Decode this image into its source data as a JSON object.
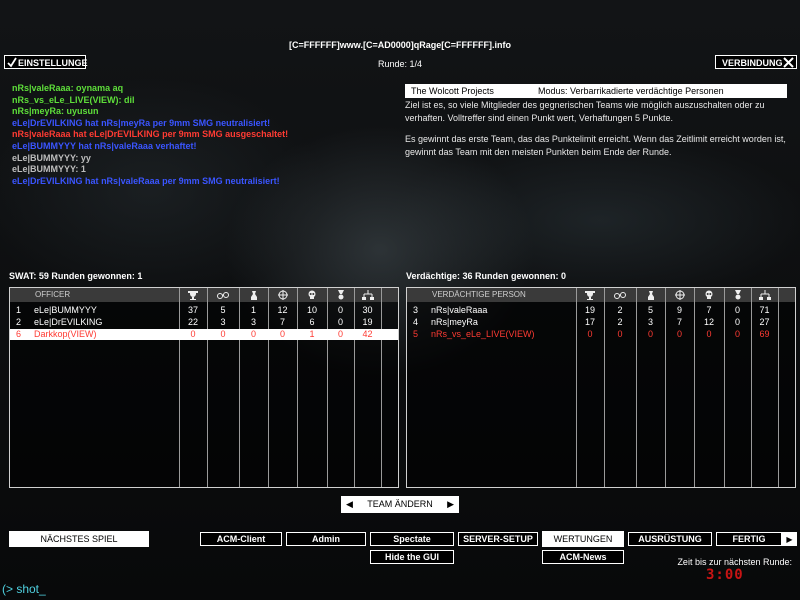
{
  "header": {
    "server_title": "[C=FFFFFF]www.[C=AD0000]qRage[C=FFFFFF].info",
    "round": "Runde: 1/4",
    "settings_button": "EINSTELLUNGE",
    "connection_button": "VERBINDUNG"
  },
  "chat": [
    {
      "parts": [
        {
          "text": "nRs|valeRaaa",
          "color": "green"
        },
        {
          "text": ": oynama aq",
          "color": "green"
        }
      ]
    },
    {
      "parts": [
        {
          "text": "nRs_vs_eLe_LIVE(VIEW)",
          "color": "green"
        },
        {
          "text": ": dil",
          "color": "green"
        }
      ]
    },
    {
      "parts": [
        {
          "text": "nRs|meyRa",
          "color": "green"
        },
        {
          "text": ": uyusun",
          "color": "green"
        }
      ]
    },
    {
      "parts": [
        {
          "text": "eLe|DrEVILKING",
          "color": "blue"
        },
        {
          "text": " hat ",
          "color": "blue"
        },
        {
          "text": "nRs|meyRa",
          "color": "blue"
        },
        {
          "text": " per 9mm SMG neutralisiert!",
          "color": "blue"
        }
      ]
    },
    {
      "parts": [
        {
          "text": "nRs|valeRaaa",
          "color": "red"
        },
        {
          "text": " hat ",
          "color": "red"
        },
        {
          "text": "eLe|DrEVILKING",
          "color": "red"
        },
        {
          "text": " per 9mm SMG ausgeschaltet!",
          "color": "red"
        }
      ]
    },
    {
      "parts": [
        {
          "text": "eLe|BUMMYYY",
          "color": "blue"
        },
        {
          "text": " hat ",
          "color": "blue"
        },
        {
          "text": "nRs|valeRaaa",
          "color": "blue"
        },
        {
          "text": " verhaftet!",
          "color": "blue"
        }
      ]
    },
    {
      "parts": [
        {
          "text": "eLe|BUMMYYY",
          "color": "gray"
        },
        {
          "text": ": yy",
          "color": "gray"
        }
      ]
    },
    {
      "parts": [
        {
          "text": "eLe|BUMMYYY",
          "color": "gray"
        },
        {
          "text": ": 1",
          "color": "gray"
        }
      ]
    },
    {
      "parts": [
        {
          "text": "eLe|DrEVILKING",
          "color": "blue"
        },
        {
          "text": " hat ",
          "color": "blue"
        },
        {
          "text": "nRs|valeRaaa",
          "color": "blue"
        },
        {
          "text": " per 9mm SMG neutralisiert!",
          "color": "blue"
        }
      ]
    }
  ],
  "info": {
    "map_name": "The Wolcott Projects",
    "mode": "Modus: Verbarrikadierte verdächtige Personen",
    "paragraph1": "Ziel ist es, so viele Mitglieder des gegnerischen Teams wie möglich auszuschalten oder zu verhaften. Volltreffer sind einen Punkt wert, Verhaftungen 5 Punkte.",
    "paragraph2": "Es gewinnt das erste Team, das das Punktelimit erreicht. Wenn das Zeitlimit erreicht worden ist, gewinnt das Team mit den meisten Punkten beim Ende der Runde."
  },
  "swat": {
    "label": "SWAT: 59   Runden gewonnen: 1",
    "header": "OFFICER",
    "rows": [
      {
        "num": "1",
        "name": "eLe|BUMMYYY",
        "stats": [
          "37",
          "5",
          "1",
          "12",
          "10",
          "0",
          "30"
        ],
        "style": "normal"
      },
      {
        "num": "2",
        "name": "eLe|DrEVILKING",
        "stats": [
          "22",
          "3",
          "3",
          "7",
          "6",
          "0",
          "19"
        ],
        "style": "normal"
      },
      {
        "num": "6",
        "name": "Darkkop(VIEW)",
        "stats": [
          "0",
          "0",
          "0",
          "0",
          "1",
          "0",
          "42"
        ],
        "style": "highlight"
      }
    ]
  },
  "suspects": {
    "label": "Verdächtige: 36   Runden gewonnen: 0",
    "header": "VERDÄCHTIGE PERSON",
    "rows": [
      {
        "num": "3",
        "name": "nRs|valeRaaa",
        "stats": [
          "19",
          "2",
          "5",
          "9",
          "7",
          "0",
          "71"
        ],
        "style": "normal"
      },
      {
        "num": "4",
        "name": "nRs|meyRa",
        "stats": [
          "17",
          "2",
          "3",
          "7",
          "12",
          "0",
          "27"
        ],
        "style": "normal"
      },
      {
        "num": "5",
        "name": "nRs_vs_eLe_LIVE(VIEW)",
        "stats": [
          "0",
          "0",
          "0",
          "0",
          "0",
          "0",
          "69"
        ],
        "style": "red"
      }
    ]
  },
  "column_icons": [
    "trophy-icon",
    "handcuffs-icon",
    "gas-mask-icon",
    "crosshair-icon",
    "skull-icon",
    "medal-icon",
    "network-icon"
  ],
  "team_change": "TEAM ÄNDERN",
  "bottom": {
    "next_game": "NÄCHSTES SPIEL",
    "acm_client": "ACM-Client",
    "admin": "Admin",
    "spectate": "Spectate",
    "server_setup": "SERVER-SETUP",
    "scores": "WERTUNGEN",
    "equipment": "AUSRÜSTUNG",
    "done": "FERTIG",
    "hide_gui": "Hide the GUI",
    "acm_news": "ACM-News",
    "next_round_label": "Zeit bis zur nächsten Runde:",
    "timer": "3:00"
  },
  "console": "(> shot_",
  "colors": {
    "green": "#5ede3a",
    "blue": "#3a55ff",
    "red": "#ff3b33",
    "gray": "#bdbdbd"
  }
}
